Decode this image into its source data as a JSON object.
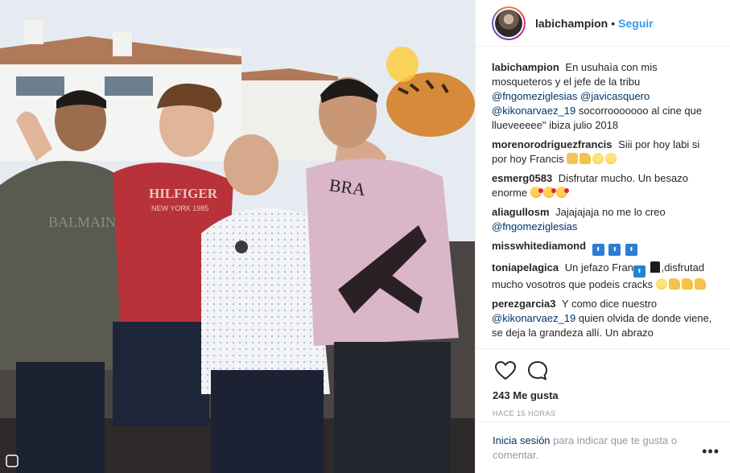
{
  "post": {
    "username": "labichampion",
    "follow_separator": "•",
    "follow_label": "Seguir",
    "likes_label": "243 Me gusta",
    "timestamp": "HACE 15 HORAS"
  },
  "photo": {
    "shirt_text_1": "HILFIGER",
    "shirt_text_2": "NEW YORK 1985",
    "shirt_text_3": "BALMAIN",
    "shirt_text_4": "BRA"
  },
  "caption": {
    "user": "labichampion",
    "text_1": "En usuhaìa con mis mosqueteros y el jefe de la tribu",
    "mention_1": "@fngomeziglesias",
    "mention_2": "@javicasquero",
    "mention_3": "@kikonarvaez_19",
    "text_2": "socorrooooooo al cine que llueveeeee\" ibiza julio 2018"
  },
  "comments": [
    {
      "user": "morenorodriguezfrancis",
      "text": "Siii por hoy labi si por hoy Francis"
    },
    {
      "user": "esmerg0583",
      "text": "Disfrutar mucho. Un besazo enorme"
    },
    {
      "user": "aliagullosm",
      "text": "Jajajajaja no me lo creo",
      "mention": "@fngomeziglesias"
    },
    {
      "user": "misswhitediamond",
      "text": ""
    },
    {
      "user": "toniapelagica",
      "text": "Un jefazo Fran",
      "text_2": ",disfrutad mucho vosotros que podeis cracks"
    },
    {
      "user": "perezgarcia3",
      "text": "Y como dice nuestro",
      "mention": "@kikonarvaez_19",
      "text_2": "quien olvida de donde viene, se deja la grandeza allí. Un abrazo"
    }
  ],
  "icons": {
    "like": "heart-icon",
    "comment": "comment-bubble-icon",
    "more": "more-options-icon"
  },
  "footer": {
    "login_label": "Inicia sesión",
    "rest_label": "para indicar que te gusta o comentar.",
    "more_label": "•••"
  },
  "colors": {
    "link": "#003569",
    "follow": "#3897f0",
    "muted": "#999999"
  }
}
